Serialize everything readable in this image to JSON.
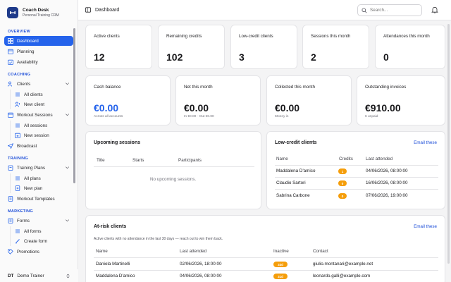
{
  "brand": {
    "name": "Coach Desk",
    "subtitle": "Personal Training CRM"
  },
  "sidebar": {
    "sections": {
      "overview": "OVERVIEW",
      "coaching": "COACHING",
      "training": "TRAINING",
      "marketing": "MARKETING"
    },
    "items": {
      "dashboard": "Dashboard",
      "planning": "Planning",
      "availability": "Availability",
      "clients": "Clients",
      "all_clients": "All clients",
      "new_client": "New client",
      "workout_sessions": "Workout Sessions",
      "all_sessions": "All sessions",
      "new_session": "New session",
      "broadcast": "Broadcast",
      "training_plans": "Training Plans",
      "all_plans": "All plans",
      "new_plan": "New plan",
      "workout_templates": "Workout Templates",
      "forms": "Forms",
      "all_forms": "All forms",
      "create_form": "Create form",
      "promotions": "Promotions"
    },
    "user": {
      "initials": "DT",
      "name": "Demo Trainer"
    }
  },
  "header": {
    "title": "Dashboard",
    "search_placeholder": "Search..."
  },
  "stats_row1": [
    {
      "label": "Active clients",
      "value": "12"
    },
    {
      "label": "Remaining credits",
      "value": "102"
    },
    {
      "label": "Low-credit clients",
      "value": "3"
    },
    {
      "label": "Sessions this month",
      "value": "2"
    },
    {
      "label": "Attendances this month",
      "value": "0"
    }
  ],
  "stats_row2": [
    {
      "label": "Cash balance",
      "value": "€0.00",
      "sub": "Across all accounts"
    },
    {
      "label": "Net this month",
      "value": "€0.00",
      "sub": "In €0.00 · Out €0.00"
    },
    {
      "label": "Collected this month",
      "value": "€0.00",
      "sub": "Money in"
    },
    {
      "label": "Outstanding invoices",
      "value": "€910.00",
      "sub": "6 unpaid"
    }
  ],
  "colors": {
    "accent": "#2563eb",
    "warning": "#f59e0b"
  },
  "upcoming": {
    "title": "Upcoming sessions",
    "columns": [
      "Title",
      "Starts",
      "Participants"
    ],
    "empty": "No upcoming sessions."
  },
  "low_credit": {
    "title": "Low-credit clients",
    "action": "Email these",
    "columns": [
      "Name",
      "Credits",
      "Last attended"
    ],
    "rows": [
      {
        "name": "Maddalena D'amico",
        "credits": "1",
        "last": "04/06/2026, 08:00:00"
      },
      {
        "name": "Claudio Sartori",
        "credits": "0",
        "last": "16/06/2026, 08:00:00"
      },
      {
        "name": "Sabrina Carbone",
        "credits": "0",
        "last": "07/06/2026, 19:00:00"
      }
    ]
  },
  "at_risk": {
    "title": "At-risk clients",
    "action": "Email these",
    "note": "Active clients with no attendance in the last 30 days — reach out to win them back.",
    "columns": [
      "Name",
      "Last attended",
      "Inactive",
      "Contact"
    ],
    "rows": [
      {
        "name": "Daniela Martinelli",
        "last": "02/06/2026, 18:00:00",
        "inactive": "33d",
        "contact": "giulio.montanari@example.net"
      },
      {
        "name": "Maddalena D'amico",
        "last": "04/06/2026, 08:00:00",
        "inactive": "31d",
        "contact": "leonardo.galli@example.com"
      }
    ]
  }
}
